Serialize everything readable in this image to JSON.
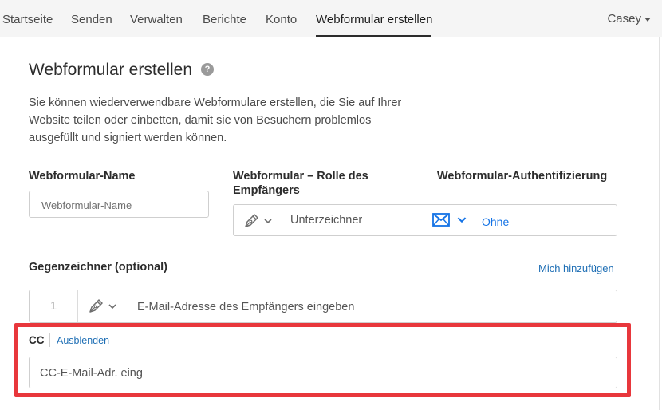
{
  "nav": {
    "items": [
      "Startseite",
      "Senden",
      "Verwalten",
      "Berichte",
      "Konto",
      "Webformular erstellen"
    ],
    "user": "Casey"
  },
  "page": {
    "title": "Webformular erstellen",
    "help": "?",
    "description": "Sie können wiederverwendbare Webformulare erstellen, die Sie auf Ihrer Website teilen oder einbetten, damit sie von Besuchern problemlos ausgefüllt und signiert werden können."
  },
  "form": {
    "name_label": "Webformular-Name",
    "name_placeholder": "Webformular-Name",
    "role_label": "Webformular – Rolle des Empfängers",
    "role_value": "Unterzeichner",
    "auth_label": "Webformular-Authentifizierung",
    "auth_value": "Ohne"
  },
  "countersigner": {
    "label": "Gegenzeichner (optional)",
    "add_me": "Mich hinzufügen",
    "number": "1",
    "email_placeholder": "E-Mail-Adresse des Empfängers eingeben"
  },
  "cc": {
    "label": "CC",
    "hide": "Ausblenden",
    "placeholder": "CC-E-Mail-Adr. eing"
  },
  "colors": {
    "accent": "#1473e6",
    "highlight": "#e8373c"
  }
}
